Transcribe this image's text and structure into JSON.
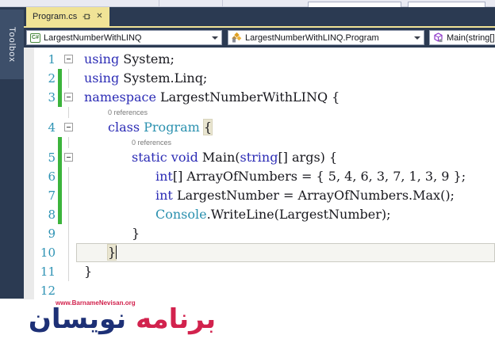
{
  "sidebar": {
    "toolbox_label": "Toolbox"
  },
  "tab": {
    "title": "Program.cs",
    "pin_icon": "pin-icon",
    "close_icon": "close-icon"
  },
  "navbar": {
    "project": "LargestNumberWithLINQ",
    "type": "LargestNumberWithLINQ.Program",
    "member": "Main(string[]",
    "project_icon": "csharp-project-icon",
    "type_icon": "class-icon",
    "member_icon": "method-icon"
  },
  "editor": {
    "codelens_label": "0 references",
    "rows": [
      {
        "type": "code",
        "num": "1",
        "fold": true,
        "indent": 0,
        "segs": [
          {
            "c": "kw",
            "t": "using"
          },
          {
            "c": "pl",
            "t": " System;"
          }
        ]
      },
      {
        "type": "code",
        "num": "2",
        "changed": true,
        "guide": true,
        "indent": 0,
        "segs": [
          {
            "c": "kw",
            "t": "using"
          },
          {
            "c": "pl",
            "t": " System.Linq;"
          }
        ]
      },
      {
        "type": "code",
        "num": "3",
        "changed": true,
        "fold": true,
        "indent": 0,
        "segs": [
          {
            "c": "kw",
            "t": "namespace"
          },
          {
            "c": "pl",
            "t": " LargestNumberWithLINQ {"
          }
        ]
      },
      {
        "type": "lens",
        "indent": 1,
        "guide": true
      },
      {
        "type": "code",
        "num": "4",
        "fold": true,
        "indent": 1,
        "segs": [
          {
            "c": "kw",
            "t": "class"
          },
          {
            "c": "pl",
            "t": " "
          },
          {
            "c": "ty",
            "t": "Program"
          },
          {
            "c": "pl",
            "t": " "
          },
          {
            "c": "hl",
            "t": "{"
          }
        ]
      },
      {
        "type": "lens",
        "indent": 2,
        "changed": true,
        "guide": true
      },
      {
        "type": "code",
        "num": "5",
        "changed": true,
        "fold": true,
        "indent": 2,
        "segs": [
          {
            "c": "kw",
            "t": "static"
          },
          {
            "c": "pl",
            "t": " "
          },
          {
            "c": "kw",
            "t": "void"
          },
          {
            "c": "pl",
            "t": " Main("
          },
          {
            "c": "kw",
            "t": "string"
          },
          {
            "c": "pl",
            "t": "[] args) {"
          }
        ]
      },
      {
        "type": "code",
        "num": "6",
        "changed": true,
        "guide": true,
        "indent": 3,
        "segs": [
          {
            "c": "kw",
            "t": "int"
          },
          {
            "c": "pl",
            "t": "[] ArrayOfNumbers = { 5, 4, 6, 3, 7, 1, 3, 9 };"
          }
        ]
      },
      {
        "type": "code",
        "num": "7",
        "changed": true,
        "guide": true,
        "indent": 3,
        "segs": [
          {
            "c": "kw",
            "t": "int"
          },
          {
            "c": "pl",
            "t": " LargestNumber = ArrayOfNumbers.Max();"
          }
        ]
      },
      {
        "type": "code",
        "num": "8",
        "changed": true,
        "guide": true,
        "indent": 3,
        "segs": [
          {
            "c": "ty",
            "t": "Console"
          },
          {
            "c": "pl",
            "t": ".WriteLine(LargestNumber);"
          }
        ]
      },
      {
        "type": "code",
        "num": "9",
        "guide": true,
        "indent": 2,
        "segs": [
          {
            "c": "pl",
            "t": "}"
          }
        ]
      },
      {
        "type": "code",
        "num": "10",
        "guide": true,
        "indent": 1,
        "current": true,
        "segs": [
          {
            "c": "hl",
            "t": "}"
          },
          {
            "c": "cursor",
            "t": ""
          }
        ]
      },
      {
        "type": "code",
        "num": "11",
        "guide": true,
        "indent": 0,
        "segs": [
          {
            "c": "pl",
            "t": "}"
          }
        ]
      },
      {
        "type": "code",
        "num": "12",
        "indent": 0,
        "segs": []
      }
    ]
  },
  "logo": {
    "url": "www.BarnameNevisan.org",
    "brand_part_red": "برنامه",
    "brand_part_navy": "نویسان",
    "brand_full": "برنامه نویسان"
  },
  "colors": {
    "navy": "#2B3A52",
    "tab_yellow": "#F0E396",
    "keyword_blue": "#2B2BB5",
    "type_teal": "#2B91AF",
    "line_number_teal": "#2E93B4",
    "change_bar_green": "#3CB43C",
    "codelens_gray": "#7A7A7A",
    "logo_navy": "#1D3076",
    "logo_red": "#D2224D"
  }
}
